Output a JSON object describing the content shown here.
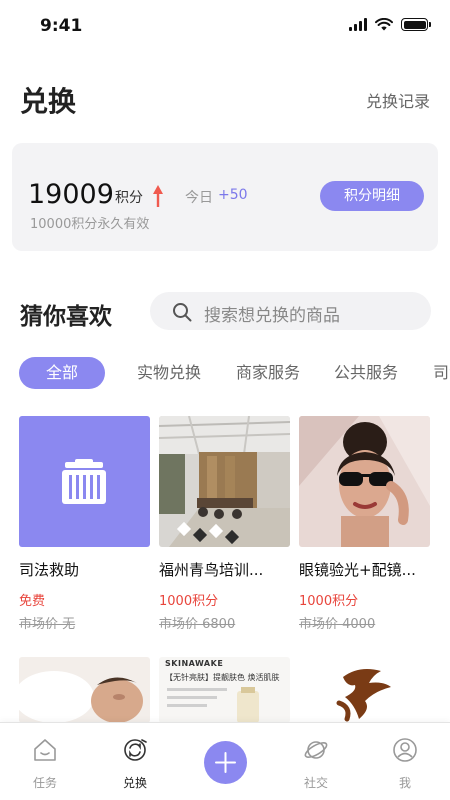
{
  "status_bar": {
    "time": "9:41"
  },
  "header": {
    "title": "兑换",
    "history_link": "兑换记录"
  },
  "points": {
    "value": "19009",
    "unit": "积分",
    "today_label": "今日",
    "today_value": "+50",
    "validity": "10000积分永久有效",
    "detail_button": "积分明细"
  },
  "recommend": {
    "title": "猜你喜欢",
    "search_placeholder": "搜索想兑换的商品"
  },
  "tabs": [
    {
      "label": "全部",
      "active": true
    },
    {
      "label": "实物兑换",
      "active": false
    },
    {
      "label": "商家服务",
      "active": false
    },
    {
      "label": "公共服务",
      "active": false
    },
    {
      "label": "司法",
      "active": false
    }
  ],
  "products": [
    {
      "name": "司法救助",
      "price": "免费",
      "market_price": "市场价 无",
      "image": "briefcase-icon"
    },
    {
      "name": "福州青鸟培训...",
      "price": "1000积分",
      "market_price": "市场价 6800",
      "image": "office-photo"
    },
    {
      "name": "眼镜验光+配镜...",
      "price": "1000积分",
      "market_price": "市场价 4000",
      "image": "sunglasses-photo"
    }
  ],
  "products_row2": [
    {
      "image": "sleeping-man-photo"
    },
    {
      "image": "skincare-ad-photo",
      "caption": "SKINAWAKE",
      "line1": "【无针亮肤】提靓肤色 焕活肌肤"
    },
    {
      "image": "calligraphy-photo"
    }
  ],
  "bottom_nav": [
    {
      "label": "任务",
      "icon": "home-icon",
      "active": false
    },
    {
      "label": "兑换",
      "icon": "exchange-icon",
      "active": true
    },
    {
      "label": "",
      "icon": "plus-icon",
      "active": false
    },
    {
      "label": "社交",
      "icon": "planet-icon",
      "active": false
    },
    {
      "label": "我",
      "icon": "user-icon",
      "active": false
    }
  ],
  "colors": {
    "accent": "#8b88f0",
    "price_red": "#e8453c",
    "arrow_red": "#f05a4f"
  }
}
